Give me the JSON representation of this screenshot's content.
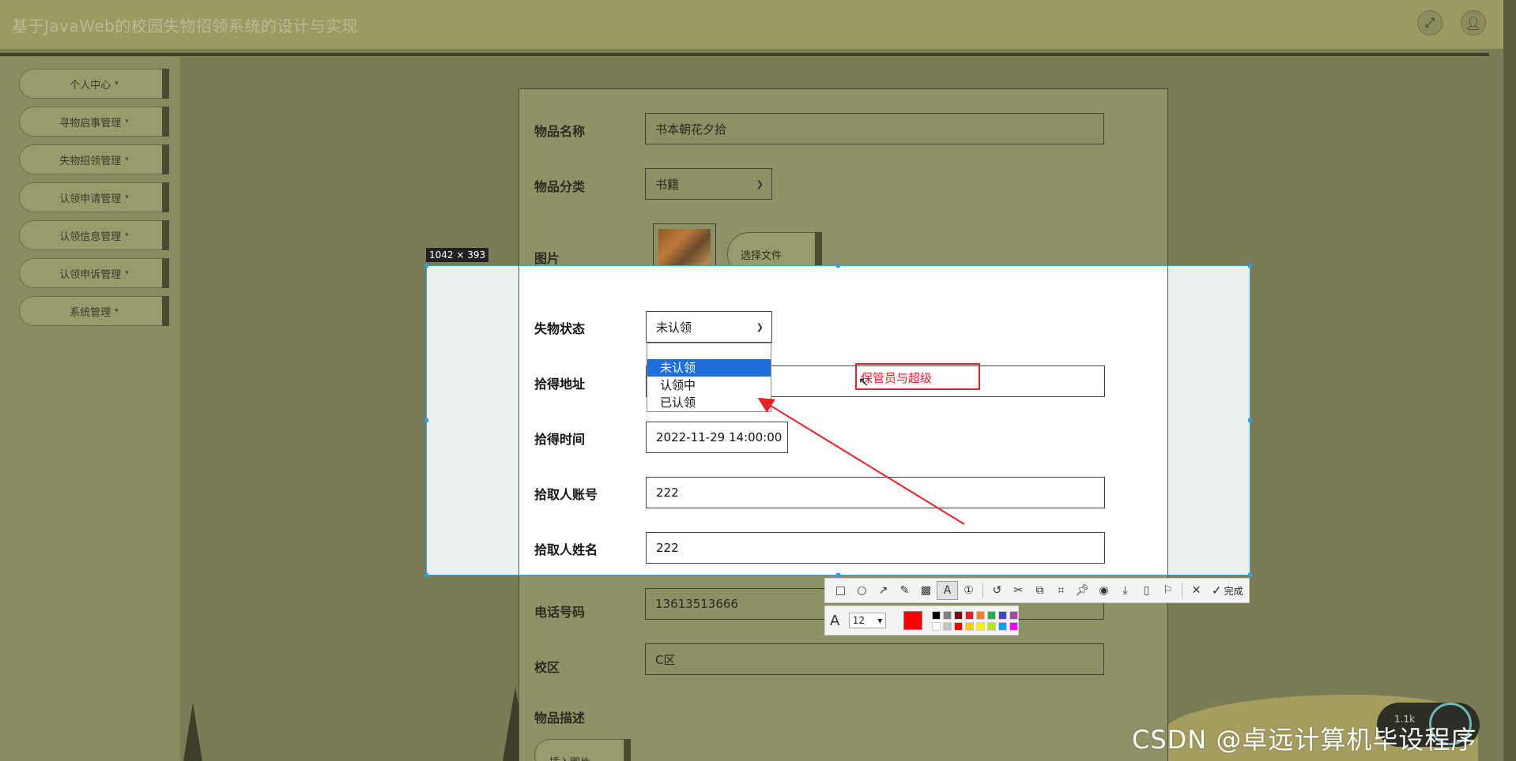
{
  "header": {
    "title": "基于JavaWeb的校园失物招领系统的设计与实现",
    "expand_icon": "fullscreen-icon",
    "user_icon": "user-icon"
  },
  "sidebar": {
    "items": [
      {
        "label": "个人中心"
      },
      {
        "label": "寻物启事管理"
      },
      {
        "label": "失物招领管理"
      },
      {
        "label": "认领申请管理"
      },
      {
        "label": "认领信息管理"
      },
      {
        "label": "认领申诉管理"
      },
      {
        "label": "系统管理"
      }
    ],
    "caret": "▾"
  },
  "form": {
    "name_label": "物品名称",
    "name_value": "书本朝花夕拾",
    "category_label": "物品分类",
    "category_value": "书籍",
    "image_label": "图片",
    "choose_file": "选择文件",
    "status_label": "失物状态",
    "status_value": "未认领",
    "address_label": "拾得地址",
    "time_label": "拾得时间",
    "time_value": "2022-11-29 14:00:00",
    "account_label": "拾取人账号",
    "account_value": "222",
    "finder_name_label": "拾取人姓名",
    "finder_name_value": "222",
    "phone_label": "电话号码",
    "phone_value": "13613513666",
    "campus_label": "校区",
    "campus_value": "C区",
    "desc_label": "物品描述",
    "insert_image": "插入图片"
  },
  "dropdown": {
    "options": [
      "未认领",
      "认领中",
      "已认领"
    ],
    "selected_index": 0
  },
  "screenshot_tool": {
    "dimensions": "1042 × 393",
    "text_annotation": "保管员与超级",
    "done_label": "完成",
    "font_size": "12",
    "current_color": "#ff0000",
    "palette": [
      "#000000",
      "#7f7f7f",
      "#880015",
      "#ed1c24",
      "#ff7f27",
      "#22b14c",
      "#3f48cc",
      "#a349a4",
      "#ffffff",
      "#c3c3c3",
      "#ff0000",
      "#ffc90e",
      "#fff200",
      "#b5e61d",
      "#00a2e8",
      "#ff00ff"
    ]
  },
  "watermark": "CSDN @卓远计算机毕设程序",
  "speed_text": "1.1k"
}
